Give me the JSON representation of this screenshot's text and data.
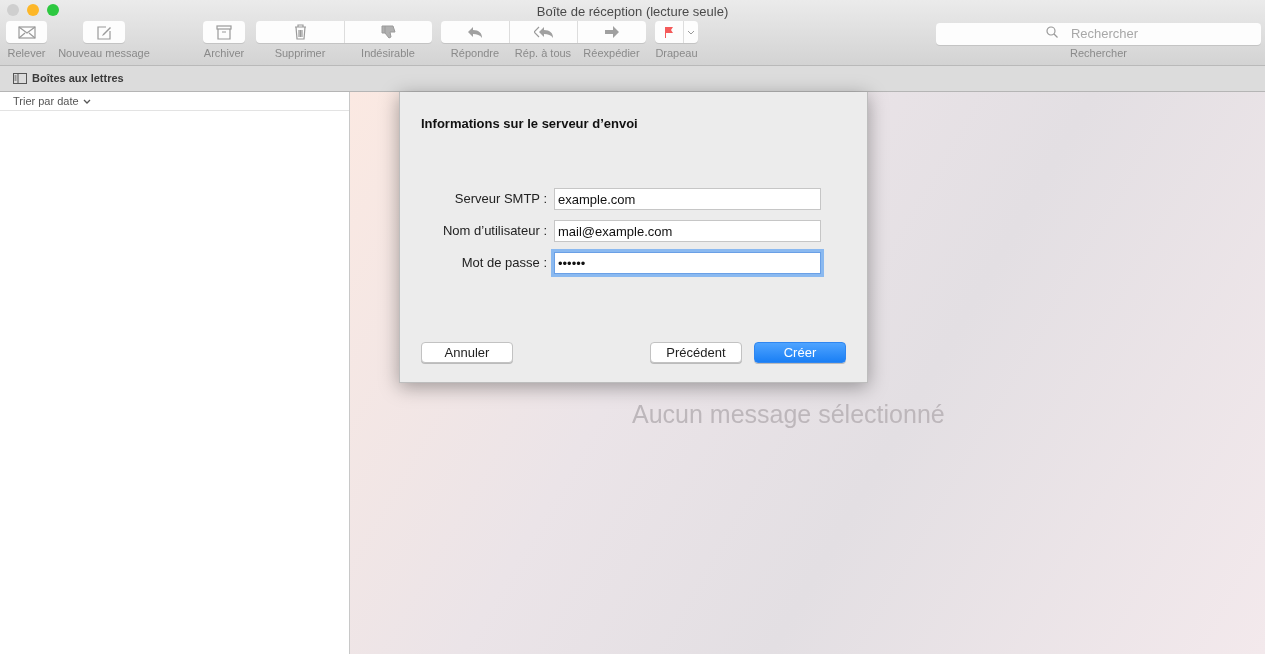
{
  "window": {
    "title": "Boîte de réception (lecture seule)"
  },
  "toolbar": [
    {
      "kind": "button",
      "label": "Relever"
    },
    {
      "kind": "button",
      "label": "Nouveau message"
    },
    {
      "kind": "button",
      "label": "Archiver"
    },
    {
      "kind": "group",
      "items": [
        {
          "label": "Supprimer"
        },
        {
          "label": "Indésirable"
        }
      ]
    },
    {
      "kind": "group",
      "items": [
        {
          "label": "Répondre"
        },
        {
          "label": "Rép. à tous"
        },
        {
          "label": "Réexpédier"
        }
      ]
    },
    {
      "kind": "flag",
      "label": "Drapeau"
    }
  ],
  "search": {
    "placeholder": "Rechercher",
    "label": "Rechercher"
  },
  "mailbox_bar": {
    "label": "Boîtes aux lettres"
  },
  "message_list": {
    "sort": "Trier par date"
  },
  "viewer": {
    "empty_text": "Aucun message sélectionné"
  },
  "dialog": {
    "title": "Informations sur le serveur d’envoi",
    "fields": [
      {
        "label": "Serveur SMTP :",
        "value": "example.com",
        "focused": false
      },
      {
        "label": "Nom d’utilisateur :",
        "value": "mail@example.com",
        "focused": false
      },
      {
        "label": "Mot de passe :",
        "value": "••••••",
        "focused": true
      }
    ],
    "buttons": [
      {
        "label": "Annuler",
        "kind": "default"
      },
      {
        "label": "Précédent",
        "kind": "default"
      },
      {
        "label": "Créer",
        "kind": "primary"
      }
    ]
  }
}
